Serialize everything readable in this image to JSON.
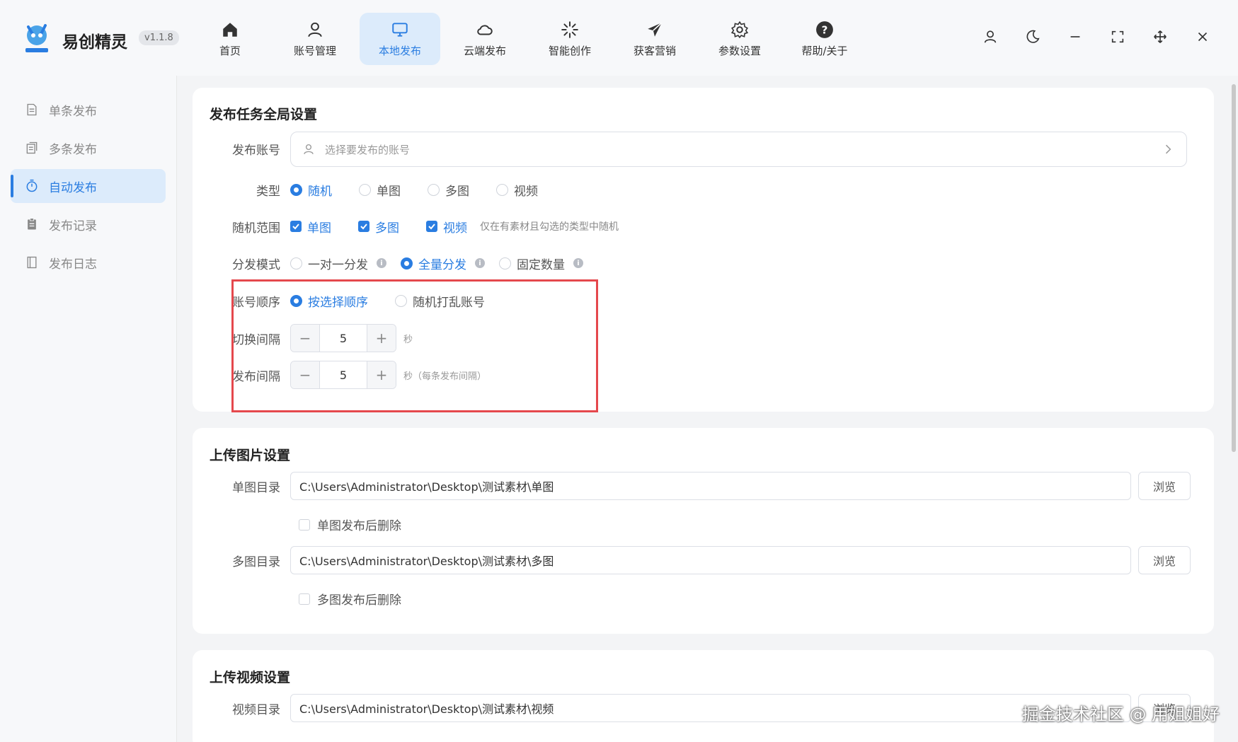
{
  "app": {
    "name": "易创精灵",
    "version": "v1.1.8"
  },
  "nav": [
    {
      "label": "首页",
      "icon": "home-icon"
    },
    {
      "label": "账号管理",
      "icon": "user-icon"
    },
    {
      "label": "本地发布",
      "icon": "monitor-icon",
      "active": true
    },
    {
      "label": "云端发布",
      "icon": "cloud-icon"
    },
    {
      "label": "智能创作",
      "icon": "sparkle-icon"
    },
    {
      "label": "获客营销",
      "icon": "send-icon"
    },
    {
      "label": "参数设置",
      "icon": "gear-icon"
    },
    {
      "label": "帮助/关于",
      "icon": "help-icon"
    }
  ],
  "sidebar": {
    "items": [
      {
        "label": "单条发布",
        "icon": "document-icon"
      },
      {
        "label": "多条发布",
        "icon": "documents-icon"
      },
      {
        "label": "自动发布",
        "icon": "timer-icon",
        "active": true
      },
      {
        "label": "发布记录",
        "icon": "clipboard-icon"
      },
      {
        "label": "发布日志",
        "icon": "book-icon"
      }
    ]
  },
  "global": {
    "title": "发布任务全局设置",
    "account_label": "发布账号",
    "account_placeholder": "选择要发布的账号",
    "type_label": "类型",
    "type_options": [
      "随机",
      "单图",
      "多图",
      "视频"
    ],
    "type_selected": "随机",
    "range_label": "随机范围",
    "range_options": [
      "单图",
      "多图",
      "视频"
    ],
    "range_hint": "仅在有素材且勾选的类型中随机",
    "mode_label": "分发模式",
    "mode_options": [
      "一对一分发",
      "全量分发",
      "固定数量"
    ],
    "mode_selected": "全量分发",
    "order_label": "账号顺序",
    "order_options": [
      "按选择顺序",
      "随机打乱账号"
    ],
    "order_selected": "按选择顺序",
    "switch_label": "切换间隔",
    "switch_value": "5",
    "switch_unit": "秒",
    "publish_label": "发布间隔",
    "publish_value": "5",
    "publish_unit": "秒（每条发布间隔）"
  },
  "images": {
    "title": "上传图片设置",
    "single_label": "单图目录",
    "single_path": "C:\\Users\\Administrator\\Desktop\\测试素材\\单图",
    "single_delete": "单图发布后删除",
    "multi_label": "多图目录",
    "multi_path": "C:\\Users\\Administrator\\Desktop\\测试素材\\多图",
    "multi_delete": "多图发布后删除",
    "browse": "浏览"
  },
  "video": {
    "title": "上传视频设置",
    "dir_label": "视频目录",
    "path": "C:\\Users\\Administrator\\Desktop\\测试素材\\视频",
    "browse": "浏览"
  },
  "watermark": "掘金技术社区 @ 用姐姐好",
  "colors": {
    "accent": "#2a7de1",
    "highlight": "#e5484d"
  }
}
